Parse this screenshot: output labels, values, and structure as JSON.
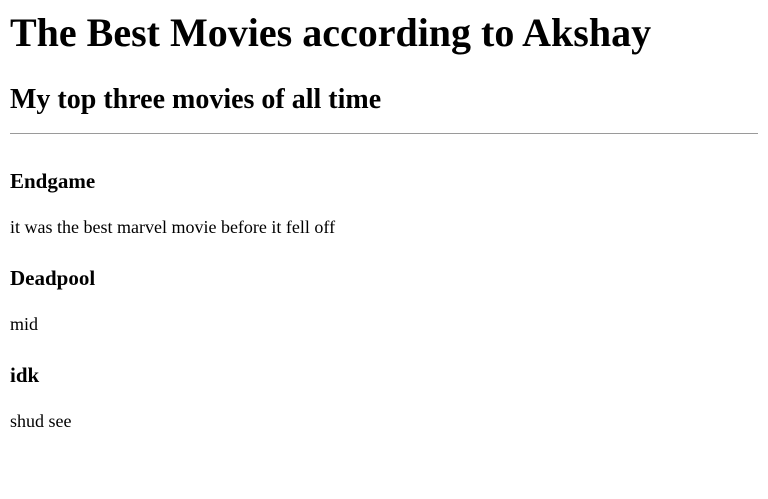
{
  "page": {
    "title": "The Best Movies according to Akshay",
    "subtitle": "My top three movies of all time"
  },
  "movies": [
    {
      "name": "Endgame",
      "description": "it was the best marvel movie before it fell off"
    },
    {
      "name": "Deadpool",
      "description": "mid"
    },
    {
      "name": "idk",
      "description": "shud see"
    }
  ],
  "colors": {
    "background": "#ffffff",
    "text": "#000000",
    "divider": "#9a9a9a"
  }
}
